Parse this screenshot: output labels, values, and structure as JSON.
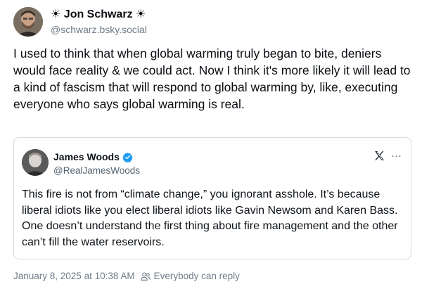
{
  "post": {
    "author": {
      "display_name": "☀ Jon Schwarz ☀",
      "handle": "@schwarz.bsky.social"
    },
    "text": "I used to think that when global warming truly began to bite, deniers would face reality & we could act. Now I think it's more likely it will lead to a kind of fascism that will respond to global warming by, like, executing everyone who says global warming is real.",
    "timestamp": "January 8, 2025 at 10:38 AM",
    "reply_setting": "Everybody can reply"
  },
  "embed": {
    "author": {
      "display_name": "James Woods",
      "handle": "@RealJamesWoods"
    },
    "text": "This fire is not from “climate change,” you ignorant asshole. It’s because liberal idiots like you elect liberal idiots like Gavin Newsom and Karen Bass. One doesn’t understand the first thing about fire management and the other can’t fill the water reservoirs.",
    "more_label": "···"
  },
  "icons": {
    "verified": "verified-badge-icon",
    "platform": "x-logo-icon",
    "more": "more-options-icon",
    "reply": "people-icon"
  },
  "colors": {
    "text": "#0b0f14",
    "muted": "#6f7b88",
    "verified": "#1d9bf0",
    "border": "#d4dbe2"
  }
}
